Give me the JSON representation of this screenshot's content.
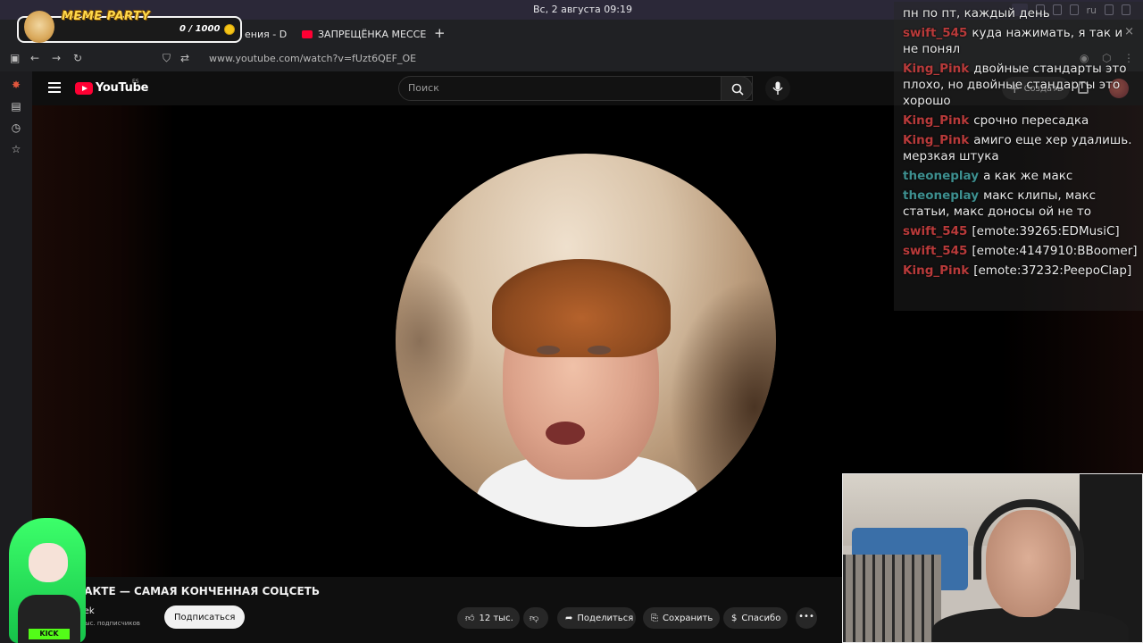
{
  "os": {
    "clock": "Вс, 2 августа  09:19",
    "lang": "ru"
  },
  "browser": {
    "tabs": [
      {
        "label": "ения - D"
      },
      {
        "label": "ЗАПРЕЩЁНКА МЕССЕН"
      }
    ],
    "tab_close": "×",
    "new_tab": "+",
    "window_close": "×",
    "url": "www.youtube.com/watch?v=fUzt6QEF_OE"
  },
  "youtube": {
    "logo_text": "YouTube",
    "logo_region": "ES",
    "search_placeholder": "Поиск",
    "create_label": "Создать",
    "create_plus": "+"
  },
  "video": {
    "title": "ТАКТЕ — САМАЯ КОНЧЕННАЯ СОЦСЕТЬ",
    "channel_name": "lek",
    "channel_subs": "тыс. подписчиков",
    "subscribe_label": "Подписаться",
    "likes_label": "12 тыс.",
    "share_label": "Поделиться",
    "save_label": "Сохранить",
    "thanks_label": "Спасибо",
    "more_label": "•••"
  },
  "overlay": {
    "meme_title": "MEME PARTY",
    "meme_counter": "0 / 1000",
    "vtuber_badge": "KICK",
    "chat": [
      {
        "user": "",
        "text": "пн по пт, каждый день",
        "color": "#e9e9e9"
      },
      {
        "user": "swift_545",
        "text": "куда нажимать, я так и не понял",
        "color": "#b83a3a"
      },
      {
        "user": "King_Pink",
        "text": "двойные стандарты это плохо, но двойные стандарты это хорошо",
        "color": "#b83a3a"
      },
      {
        "user": "King_Pink",
        "text": "срочно пересадка",
        "color": "#b83a3a"
      },
      {
        "user": "King_Pink",
        "text": "амиго еще хер удалишь. мерзкая штука",
        "color": "#b83a3a"
      },
      {
        "user": "theoneplay",
        "text": "а как же макс",
        "color": "#3d8f8f"
      },
      {
        "user": "theoneplay",
        "text": "макс клипы, макс статьи, макс доносы ой не то",
        "color": "#3d8f8f"
      },
      {
        "user": "swift_545",
        "text": "[emote:39265:EDMusiC]",
        "color": "#b83a3a"
      },
      {
        "user": "swift_545",
        "text": "[emote:4147910:BBoomer]",
        "color": "#b83a3a"
      },
      {
        "user": "King_Pink",
        "text": "[emote:37232:PeepoClap]",
        "color": "#b83a3a"
      }
    ]
  }
}
